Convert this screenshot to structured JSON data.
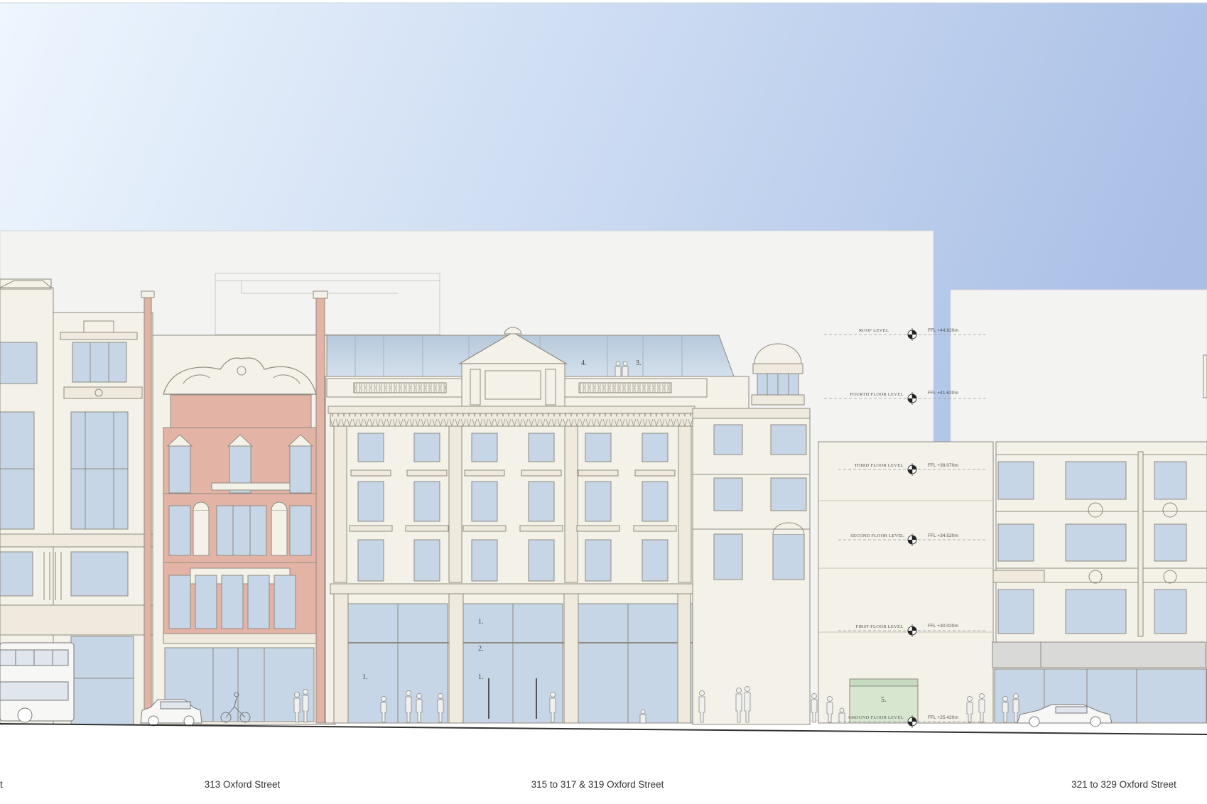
{
  "colors": {
    "sky_light": "#eaf3fd",
    "sky_dark": "#a9bfe6",
    "bg_block": "#f3f3f2",
    "facade": "#f4f1e8",
    "pink": "#e3b4a6",
    "glass": "#c7d6e6",
    "line": "#8e8a80",
    "ground": "#333333",
    "green": "#d7e7cf"
  },
  "levels": [
    {
      "label": "ROOF LEVEL",
      "value": "FFL +44.820m"
    },
    {
      "label": "FOURTH FLOOR LEVEL",
      "value": "FFL +41.620m"
    },
    {
      "label": "THIRD FLOOR LEVEL",
      "value": "FFL +38.070m"
    },
    {
      "label": "SECOND FLOOR LEVEL",
      "value": "FFL +34.520m"
    },
    {
      "label": "FIRST FLOOR LEVEL",
      "value": "FFL +30.020m"
    },
    {
      "label": "GROUND FLOOR LEVEL",
      "value": "FFL +25.420m"
    }
  ],
  "annotations": [
    "1.",
    "1.",
    "1.",
    "2.",
    "3.",
    "4.",
    "5."
  ],
  "addresses": [
    {
      "text": "t"
    },
    {
      "text": "313 Oxford Street"
    },
    {
      "text": "315 to 317 & 319 Oxford Street"
    },
    {
      "text": "321 to 329 Oxford Street"
    }
  ]
}
